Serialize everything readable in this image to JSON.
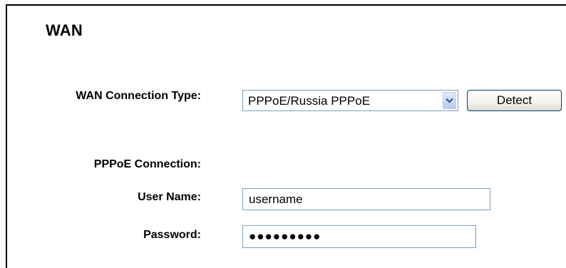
{
  "page": {
    "title": "WAN"
  },
  "wan_connection_type": {
    "label": "WAN Connection Type:",
    "selected_value": "PPPoE/Russia PPPoE",
    "detect_button_label": "Detect"
  },
  "pppoe": {
    "section_label": "PPPoE Connection:",
    "username_label": "User Name:",
    "username_value": "username",
    "password_label": "Password:",
    "password_value": "●●●●●●●●●"
  },
  "icons": {
    "dropdown_arrow": "chevron-down-icon"
  },
  "colors": {
    "dropdown_arrow": "#4d6185",
    "input_border": "#7f9db9",
    "button_border": "#003c74"
  }
}
